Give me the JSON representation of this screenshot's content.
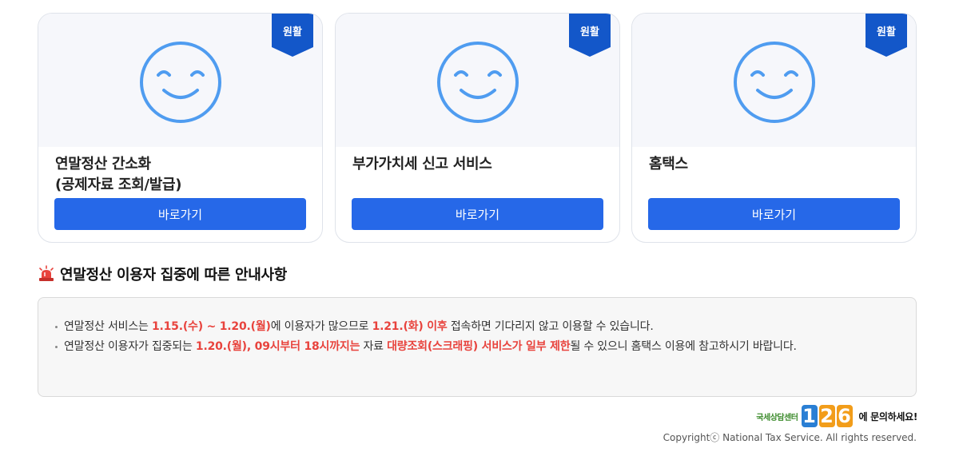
{
  "cards": [
    {
      "badge": "원활",
      "title": "연말정산 간소화\n(공제자료 조회/발급)",
      "button": "바로가기"
    },
    {
      "badge": "원활",
      "title": "부가가치세 신고 서비스",
      "button": "바로가기"
    },
    {
      "badge": "원활",
      "title": "홈택스",
      "button": "바로가기"
    }
  ],
  "notice": {
    "title": "연말정산 이용자 집중에 따른 안내사항",
    "item1": {
      "t1": "연말정산 서비스는 ",
      "h1": "1.15.(수) ~ 1.20.(월)",
      "t2": "에 이용자가 많으므로 ",
      "h2": "1.21.(화) 이후",
      "t3": " 접속하면 기다리지 않고 이용할 수 있습니다."
    },
    "item2": {
      "t1": "연말정산 이용자가 집중되는 ",
      "h1": "1.20.(월), 09시부터 18시까지는",
      "t2": " 자료 ",
      "h2": "대량조회(스크래핑) 서비스가 일부 제한",
      "t3": "될 수 있으니 홈택스 이용에 참고하시기 바랍니다."
    }
  },
  "footer": {
    "contact_prefix": "국세상담센터",
    "contact_digits": [
      "1",
      "2",
      "6"
    ],
    "contact_suffix": "에 문의하세요!",
    "copyright": "Copyrightⓒ National Tax Service. All rights reserved."
  },
  "colors": {
    "primary": "#2668e8",
    "badge": "#1357c9",
    "smiley": "#4f9cf0",
    "highlight": "#e8433d",
    "digit1": "#2a7fd4",
    "digit2": "#f29d1a",
    "digit3": "#f29d1a"
  },
  "icons": [
    "smiley-icon",
    "status-ribbon",
    "siren-icon"
  ]
}
